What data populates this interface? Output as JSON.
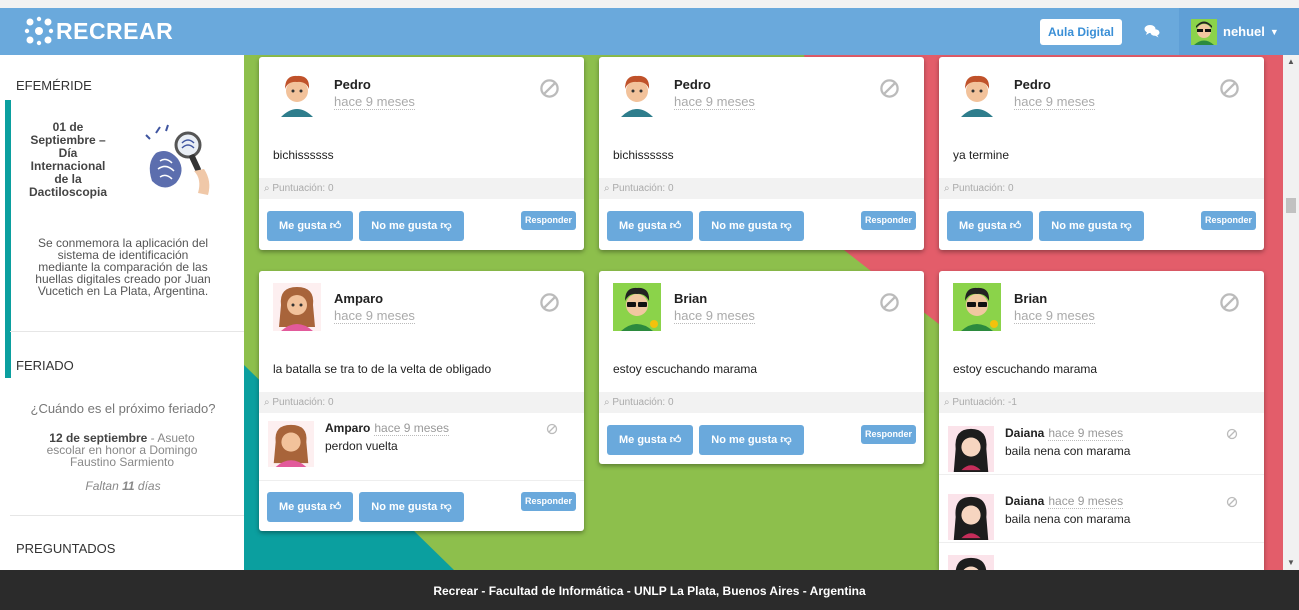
{
  "header": {
    "brand": "RECREAR",
    "aula_label": "Aula Digital",
    "user_name": "nehuel"
  },
  "sidebar": {
    "efemeride": {
      "heading": "EFEMÉRIDE",
      "date_lines": [
        "01 de",
        "Septiembre –",
        "Día",
        "Internacional",
        "de la",
        "Dactiloscopia"
      ],
      "description_lines": [
        "Se conmemora la aplicación del",
        "sistema de identificación",
        "mediante la comparación de las",
        "huellas digitales creado por Juan",
        "Vucetich en La Plata, Argentina."
      ]
    },
    "feriado": {
      "heading": "FERIADO",
      "question": "¿Cuándo es el próximo feriado?",
      "date": "12 de septiembre",
      "desc_lines": [
        " - Asueto",
        "escolar en honor a Domingo",
        "Faustino Sarmiento"
      ],
      "remaining_prefix": "Faltan ",
      "remaining_days": "11",
      "remaining_suffix": " días"
    },
    "preguntados": {
      "heading": "PREGUNTADOS"
    }
  },
  "buttons": {
    "like": "Me gusta",
    "dislike": "No me gusta",
    "reply": "Responder"
  },
  "posts": [
    {
      "name": "Pedro",
      "time": "hace 9 meses",
      "text": "bichissssss",
      "score": "Puntuación: 0"
    },
    {
      "name": "Pedro",
      "time": "hace 9 meses",
      "text": "bichissssss",
      "score": "Puntuación: 0"
    },
    {
      "name": "Pedro",
      "time": "hace 9 meses",
      "text": "ya termine",
      "score": "Puntuación: 0"
    },
    {
      "name": "Amparo",
      "time": "hace 9 meses",
      "text": "la batalla se tra to de la velta de obligado",
      "score": "Puntuación: 0",
      "replies": [
        {
          "name": "Amparo",
          "time": "hace 9 meses",
          "text": "perdon vuelta"
        }
      ]
    },
    {
      "name": "Brian",
      "time": "hace 9 meses",
      "text": "estoy escuchando marama",
      "score": "Puntuación: 0"
    },
    {
      "name": "Brian",
      "time": "hace 9 meses",
      "text": "estoy escuchando marama",
      "score": "Puntuación: -1",
      "replies": [
        {
          "name": "Daiana",
          "time": "hace 9 meses",
          "text": "baila nena con marama"
        },
        {
          "name": "Daiana",
          "time": "hace 9 meses",
          "text": "baila nena con marama"
        }
      ]
    }
  ],
  "footer": {
    "brand": "Recrear",
    "sep": " - ",
    "faculty": "Facultad de Informática",
    "location": " - UNLP La Plata, Buenos Aires - Argentina"
  },
  "colors": {
    "primary": "#6aa9dc",
    "teal": "#0b9f9f",
    "green": "#8dbf4c",
    "red": "#e35d6a",
    "footer": "#2b2b2b"
  }
}
